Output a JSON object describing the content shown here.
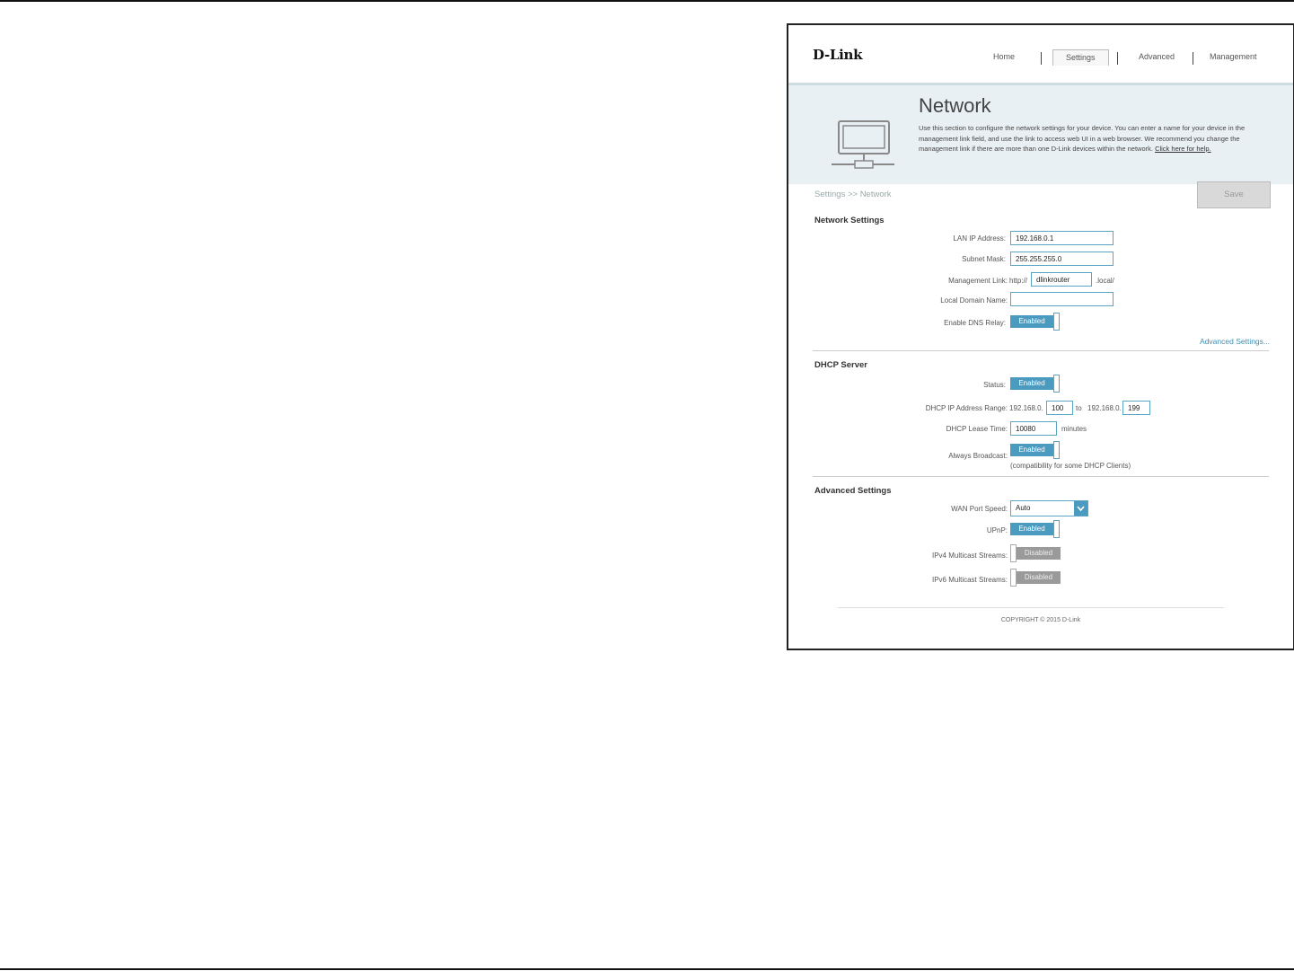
{
  "header": {
    "logo": "D-Link",
    "nav": [
      "Home",
      "Settings",
      "Advanced",
      "Management"
    ]
  },
  "banner": {
    "title": "Network",
    "description": "Use this section to configure the network settings for your device. You can enter a name for your device in the management link field, and use the link to access web UI in a web browser. We recommend you change the management link if there are more than one D-Link devices within the network.",
    "help_link": "Click here for help."
  },
  "breadcrumb": "Settings >> Network",
  "save_label": "Save",
  "network_settings": {
    "title": "Network Settings",
    "lan_ip_label": "LAN IP Address:",
    "lan_ip_value": "192.168.0.1",
    "subnet_label": "Subnet Mask:",
    "subnet_value": "255.255.255.0",
    "mgmt_label": "Management Link:",
    "mgmt_prefix": "http://",
    "mgmt_value": "dlinkrouter",
    "mgmt_suffix": ".local/",
    "domain_label": "Local Domain Name:",
    "domain_value": "",
    "dns_relay_label": "Enable DNS Relay:",
    "dns_relay_state": "Enabled",
    "advanced_link": "Advanced Settings..."
  },
  "dhcp": {
    "title": "DHCP Server",
    "status_label": "Status:",
    "status_state": "Enabled",
    "range_label": "DHCP IP Address Range:",
    "range_prefix": "192.168.0.",
    "range_start": "100",
    "range_to": "to",
    "range_prefix2": "192.168.0.",
    "range_end": "199",
    "lease_label": "DHCP Lease Time:",
    "lease_value": "10080",
    "lease_unit": "minutes",
    "broadcast_label": "Always Broadcast:",
    "broadcast_state": "Enabled",
    "broadcast_note": "(compatibility for some DHCP Clients)"
  },
  "advanced": {
    "title": "Advanced Settings",
    "wan_label": "WAN Port Speed:",
    "wan_value": "Auto",
    "upnp_label": "UPnP:",
    "upnp_state": "Enabled",
    "ipv4_label": "IPv4 Multicast Streams:",
    "ipv4_state": "Disabled",
    "ipv6_label": "IPv6 Multicast Streams:",
    "ipv6_state": "Disabled"
  },
  "footer": {
    "copyright": "COPYRIGHT © 2015 D-Link"
  },
  "colors": {
    "accent": "#4a9bbf",
    "disabled": "#9a9a9a",
    "banner": "#e8f0f4"
  }
}
